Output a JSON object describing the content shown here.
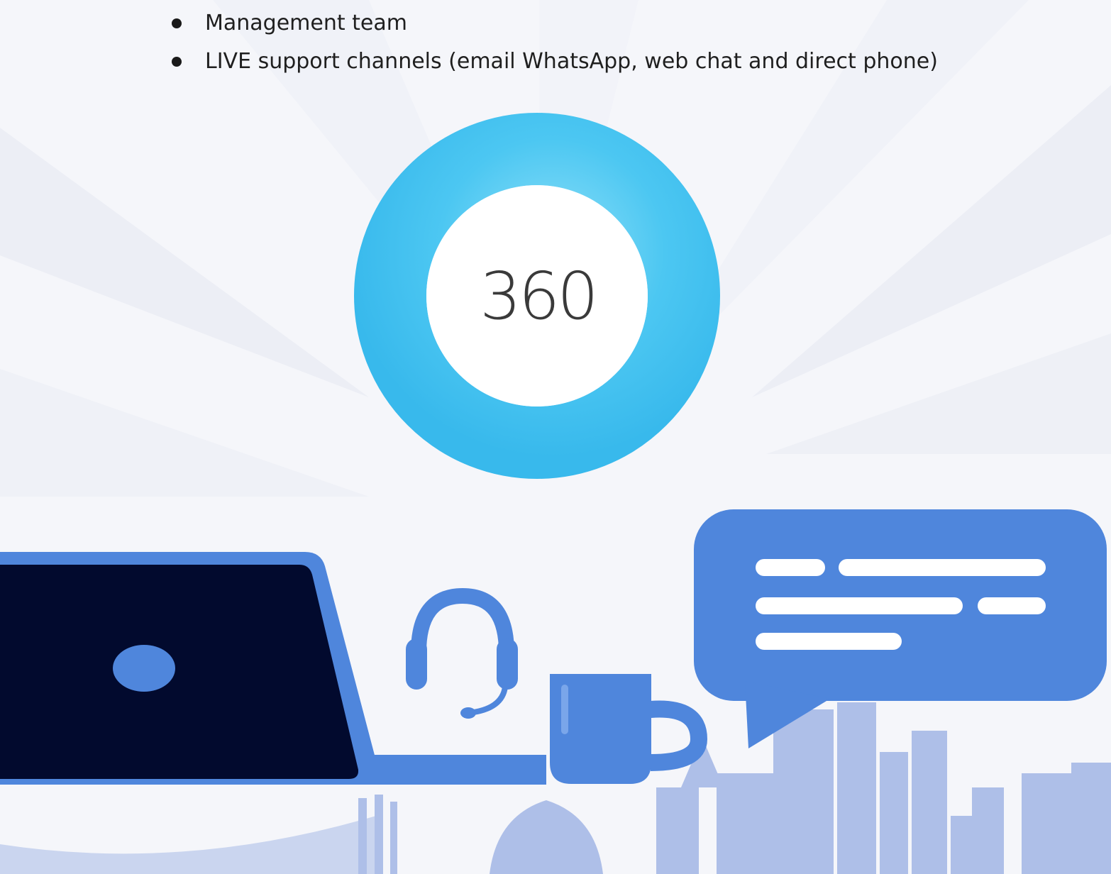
{
  "bullet_list": {
    "items": [
      {
        "text": "Management team"
      },
      {
        "text": "LIVE support channels (email WhatsApp, web chat and direct phone)"
      }
    ]
  },
  "badge": {
    "number": "360"
  },
  "colors": {
    "ring": "#45c4f0",
    "primary_blue": "#4f86dc",
    "laptop_screen": "#020a2e",
    "skyline": "#aebfe8"
  },
  "icons": [
    "laptop-icon",
    "headset-icon",
    "coffee-mug-icon",
    "chat-bubble-icon",
    "city-skyline"
  ]
}
